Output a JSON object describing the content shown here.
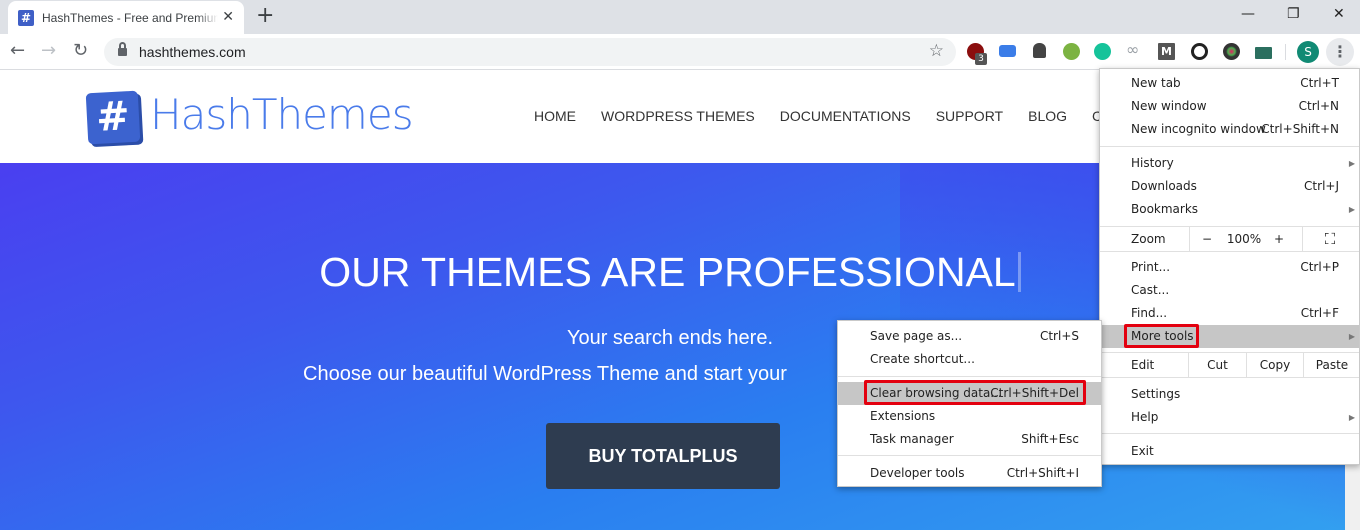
{
  "browser": {
    "tab": {
      "title": "HashThemes - Free and Premium WordPress Themes",
      "favicon": "hash-icon"
    },
    "new_tab_symbol": "+",
    "window_controls": {
      "minimize": "—",
      "restore": "❐",
      "close": "✕"
    },
    "nav": {
      "back": "←",
      "forward": "→",
      "reload": "↻"
    },
    "url": "hashthemes.com",
    "bookmark_star": "☆",
    "extensions": [
      {
        "name": "ublock-origin-icon",
        "color": "#8b0e0e",
        "badge": "3"
      },
      {
        "name": "translator-icon",
        "color": "#3b7de8"
      },
      {
        "name": "ghostery-icon",
        "color": "#444444"
      },
      {
        "name": "green-circle-extension-icon",
        "color": "#7cb342"
      },
      {
        "name": "grammarly-icon",
        "color": "#15c39a"
      },
      {
        "name": "infinity-icon",
        "color": "#9aa0a6"
      },
      {
        "name": "m-extension-icon",
        "color": "#555555"
      },
      {
        "name": "search-tool-icon",
        "color": "#222222"
      },
      {
        "name": "color-picker-icon",
        "color": "#333333"
      },
      {
        "name": "new-badge-extension-icon",
        "color": "#2b6f5f"
      }
    ],
    "profile_initial": "S",
    "menu_dots": "⋮",
    "accent_colors": {
      "profile": "#118a74",
      "highlight_box": "#e3000f",
      "menu_hover": "#c6c6c6"
    }
  },
  "site": {
    "logo_symbol": "#",
    "logo_text": "HashThemes",
    "nav": [
      "HOME",
      "WORDPRESS THEMES",
      "DOCUMENTATIONS",
      "SUPPORT",
      "BLOG",
      "CONT"
    ],
    "hero": {
      "title": "OUR THEMES ARE PROFESSIONAL",
      "subtitle1": "Your search ends here.",
      "subtitle2": "Choose our beautiful WordPress Theme and start your",
      "cta": "BUY TOTALPLUS"
    }
  },
  "menu": {
    "new_tab": {
      "label": "New tab",
      "shortcut": "Ctrl+T"
    },
    "new_window": {
      "label": "New window",
      "shortcut": "Ctrl+N"
    },
    "new_incognito": {
      "label": "New incognito window",
      "shortcut": "Ctrl+Shift+N"
    },
    "history": {
      "label": "History",
      "arrow": "▶"
    },
    "downloads": {
      "label": "Downloads",
      "shortcut": "Ctrl+J"
    },
    "bookmarks": {
      "label": "Bookmarks",
      "arrow": "▶"
    },
    "zoom": {
      "label": "Zoom",
      "minus": "−",
      "value": "100%",
      "plus": "+",
      "fullscreen": "⛶"
    },
    "print": {
      "label": "Print...",
      "shortcut": "Ctrl+P"
    },
    "cast": {
      "label": "Cast..."
    },
    "find": {
      "label": "Find...",
      "shortcut": "Ctrl+F"
    },
    "more_tools": {
      "label": "More tools",
      "arrow": "▶"
    },
    "edit": {
      "label": "Edit",
      "cut": "Cut",
      "copy": "Copy",
      "paste": "Paste"
    },
    "settings": {
      "label": "Settings"
    },
    "help": {
      "label": "Help",
      "arrow": "▶"
    },
    "exit": {
      "label": "Exit"
    }
  },
  "submenu": {
    "save_page": {
      "label": "Save page as...",
      "shortcut": "Ctrl+S"
    },
    "create_shortcut": {
      "label": "Create shortcut..."
    },
    "clear_browsing": {
      "label": "Clear browsing data...",
      "shortcut": "Ctrl+Shift+Del"
    },
    "extensions": {
      "label": "Extensions"
    },
    "task_manager": {
      "label": "Task manager",
      "shortcut": "Shift+Esc"
    },
    "developer_tools": {
      "label": "Developer tools",
      "shortcut": "Ctrl+Shift+I"
    }
  }
}
